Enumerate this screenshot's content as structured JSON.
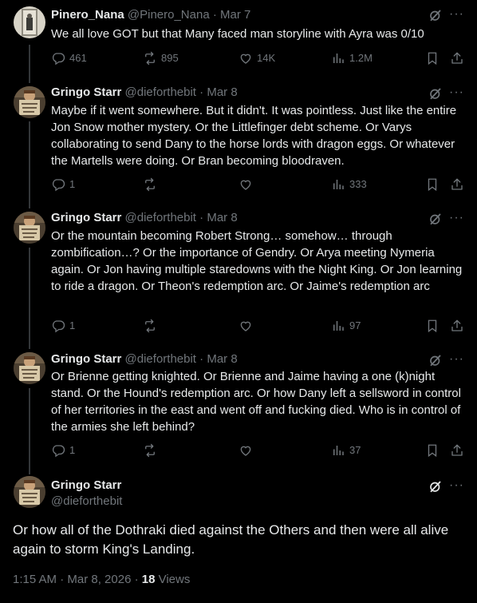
{
  "posts": [
    {
      "name": "Pinero_Nana",
      "handle": "@Pinero_Nana",
      "sep": "·",
      "date": "Mar 7",
      "text": "We all love GOT but that Many faced man storyline with Ayra was 0/10",
      "replies": "461",
      "reposts": "895",
      "likes": "14K",
      "views": "1.2M"
    },
    {
      "name": "Gringo Starr",
      "handle": "@dieforthebit",
      "sep": "·",
      "date": "Mar 8",
      "text": "Maybe if it went somewhere. But it didn't. It was pointless. Just like the entire Jon Snow mother mystery. Or the Littlefinger debt scheme. Or Varys collaborating to send Dany to the horse lords with dragon eggs. Or whatever the Martells were doing. Or Bran becoming bloodraven.",
      "replies": "1",
      "reposts": "",
      "likes": "",
      "views": "333"
    },
    {
      "name": "Gringo Starr",
      "handle": "@dieforthebit",
      "sep": "·",
      "date": "Mar 8",
      "text": "Or the mountain becoming Robert Strong… somehow… through zombification…? Or the importance of Gendry. Or Arya meeting Nymeria again. Or Jon having multiple staredowns with the Night King. Or Jon learning to ride a dragon. Or Theon's redemption arc. Or Jaime's redemption arc",
      "replies": "1",
      "reposts": "",
      "likes": "",
      "views": "97"
    },
    {
      "name": "Gringo Starr",
      "handle": "@dieforthebit",
      "sep": "·",
      "date": "Mar 8",
      "text": "Or Brienne getting knighted. Or Brienne and Jaime having a one (k)night stand. Or the Hound's redemption arc. Or how Dany left a sellsword in control of her territories in the east and went off and fucking died. Who is in control of the armies she left behind?",
      "replies": "1",
      "reposts": "",
      "likes": "",
      "views": "37"
    }
  ],
  "main": {
    "name": "Gringo Starr",
    "handle": "@dieforthebit",
    "text": "Or how all of the Dothraki died against the Others and then were all alive again to storm King's Landing.",
    "time": "1:15 AM · Mar 8, 2026 · ",
    "views_count": "18",
    "views_label": " Views"
  },
  "icons": {
    "reply": "reply-icon",
    "repost": "repost-icon",
    "like": "heart-icon",
    "views": "views-icon",
    "bookmark": "bookmark-icon",
    "share": "share-icon",
    "grok": "grok-icon",
    "more": "more-icon"
  },
  "colors": {
    "background": "#000000",
    "text": "#e7e9ea",
    "secondary": "#71767b",
    "thread_line": "#333639"
  }
}
